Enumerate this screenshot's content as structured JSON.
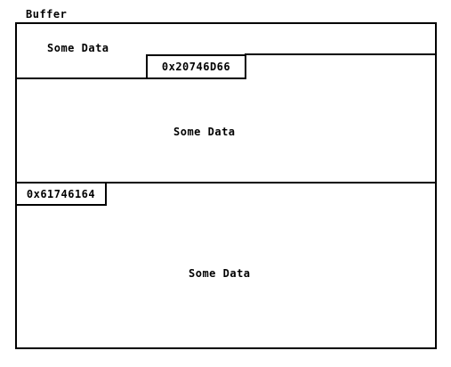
{
  "title": "Buffer",
  "regions": [
    {
      "label": "Some Data"
    },
    {
      "label": "Some Data"
    },
    {
      "label": "Some Data"
    }
  ],
  "addresses": [
    {
      "value": "0x20746D66"
    },
    {
      "value": "0x61746164"
    }
  ]
}
